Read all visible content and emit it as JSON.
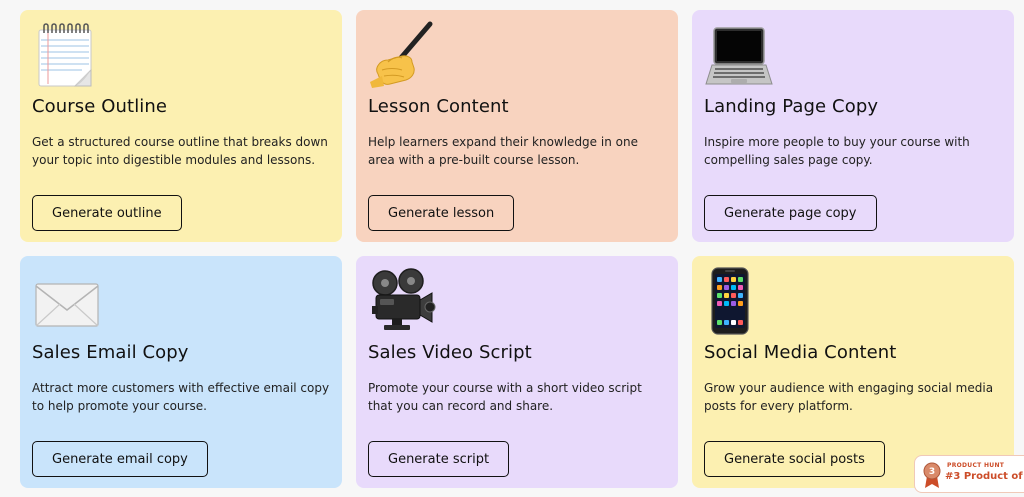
{
  "cards": [
    {
      "icon": "notepad-icon",
      "title": "Course Outline",
      "description": "Get a structured course outline that breaks down your topic into digestible modules and lessons.",
      "button": "Generate outline",
      "bg": "#fcf0b1"
    },
    {
      "icon": "writing-hand-icon",
      "title": "Lesson Content",
      "description": "Help learners expand their knowledge in one area with a pre-built course lesson.",
      "button": "Generate lesson",
      "bg": "#f8d3bf"
    },
    {
      "icon": "laptop-icon",
      "title": "Landing Page Copy",
      "description": "Inspire more people to buy your course with compelling sales page copy.",
      "button": "Generate page copy",
      "bg": "#e8dafb"
    },
    {
      "icon": "envelope-icon",
      "title": "Sales Email Copy",
      "description": "Attract more customers with effective email copy to help promote your course.",
      "button": "Generate email copy",
      "bg": "#c9e4fb"
    },
    {
      "icon": "movie-camera-icon",
      "title": "Sales Video Script",
      "description": "Promote your course with a short video script that you can record and share.",
      "button": "Generate script",
      "bg": "#e8dafb"
    },
    {
      "icon": "mobile-phone-icon",
      "title": "Social Media Content",
      "description": "Grow your audience with engaging social media posts for every platform.",
      "button": "Generate social posts",
      "bg": "#fcf0b1"
    }
  ],
  "product_hunt": {
    "medal_number": "3",
    "label": "PRODUCT HUNT",
    "text": "#3 Product of th"
  },
  "colors": {
    "accent": "#cc4d29",
    "text": "#111111"
  }
}
